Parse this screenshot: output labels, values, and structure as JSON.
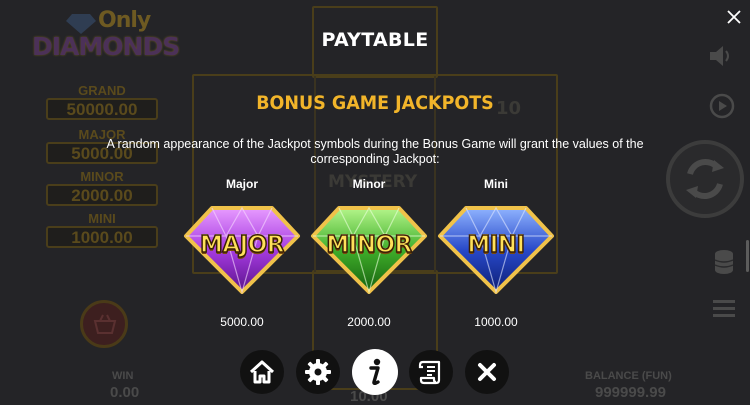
{
  "paytable": {
    "title": "PAYTABLE",
    "section_title": "BONUS GAME JACKPOTS",
    "description": "A random appearance of the Jackpot symbols during the Bonus Game will grant the values of the corresponding Jackpot:",
    "symbols": [
      {
        "name": "Major",
        "gem_text": "MAJOR",
        "gem_color": "#a63be0",
        "value": "5000.00"
      },
      {
        "name": "Minor",
        "gem_text": "MINOR",
        "gem_color": "#3fae2a",
        "value": "2000.00"
      },
      {
        "name": "Mini",
        "gem_text": "MINI",
        "gem_color": "#2849c9",
        "value": "1000.00"
      }
    ]
  },
  "background_game": {
    "logo_top": "Only",
    "logo_bottom": "DIAMONDS",
    "jackpots": [
      {
        "label": "GRAND",
        "value": "50000.00"
      },
      {
        "label": "MAJOR",
        "value": "5000.00"
      },
      {
        "label": "MINOR",
        "value": "2000.00"
      },
      {
        "label": "MINI",
        "value": "1000.00"
      }
    ],
    "reel_texts": {
      "mystery": "MYSTERY",
      "multiplier": "10"
    },
    "win_label": "WIN",
    "win_value": "0.00",
    "bet_value": "10.00",
    "balance_label": "BALANCE (FUN)",
    "balance_value": "999999.99"
  },
  "nav": {
    "active": "info",
    "items": [
      "home",
      "settings",
      "info",
      "rules",
      "close"
    ]
  },
  "colors": {
    "accent_gold": "#f2b52a",
    "overlay_bg": "#242427",
    "nav_button_bg": "#111111"
  }
}
